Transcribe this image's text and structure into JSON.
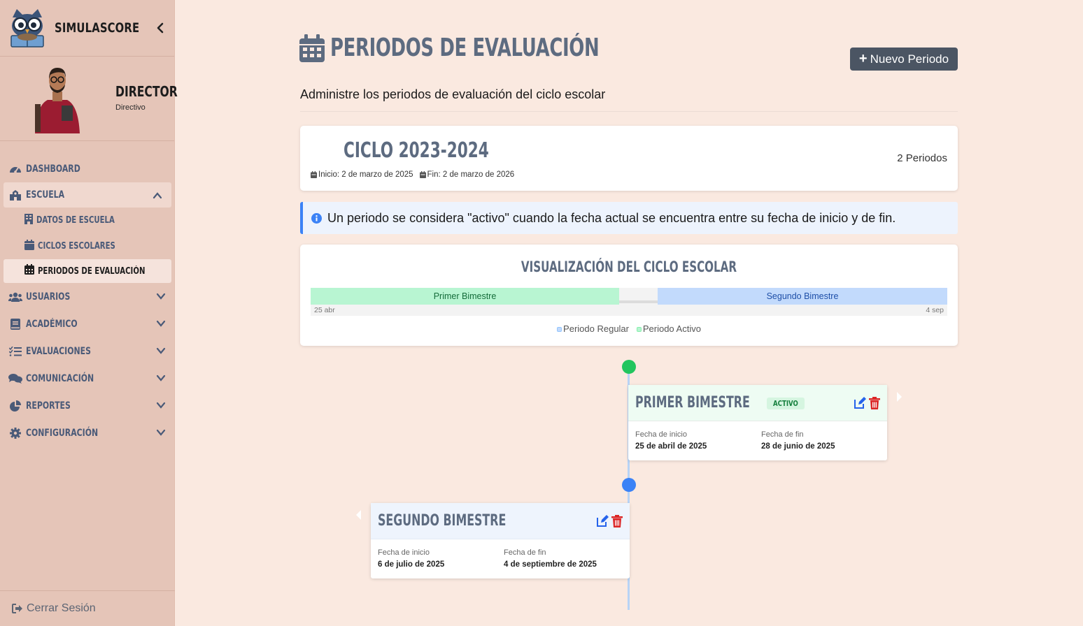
{
  "app": {
    "name": "SIMULASCORE"
  },
  "profile": {
    "role": "DIRECTOR",
    "subtitle": "Directivo"
  },
  "sidebar": {
    "items": [
      {
        "label": "DASHBOARD",
        "icon": "gauge-icon"
      },
      {
        "label": "ESCUELA",
        "icon": "school-icon",
        "expanded": true,
        "children": [
          {
            "label": "DATOS DE ESCUELA",
            "icon": "building-icon"
          },
          {
            "label": "CICLOS ESCOLARES",
            "icon": "calendar-icon"
          },
          {
            "label": "PERIODOS DE EVALUACIÓN",
            "icon": "calendar-days-icon",
            "active": true
          }
        ]
      },
      {
        "label": "USUARIOS",
        "icon": "users-icon"
      },
      {
        "label": "ACADÉMICO",
        "icon": "book-icon"
      },
      {
        "label": "EVALUACIONES",
        "icon": "list-check-icon"
      },
      {
        "label": "COMUNICACIÓN",
        "icon": "comments-icon"
      },
      {
        "label": "REPORTES",
        "icon": "chart-pie-icon"
      },
      {
        "label": "CONFIGURACIÓN",
        "icon": "gear-icon"
      }
    ],
    "logout_label": "Cerrar Sesión"
  },
  "header": {
    "title": "PERIODOS DE EVALUACIÓN",
    "subtitle": "Administre los periodos de evaluación del ciclo escolar",
    "new_button_label": "Nuevo Periodo"
  },
  "cycle": {
    "name": "CICLO 2023-2024",
    "start_label": "Inicio: 2 de marzo de 2025",
    "end_label": "Fin: 2 de marzo de 2026",
    "period_count": "2 Periodos"
  },
  "info_message": "Un periodo se considera \"activo\" cuando la fecha actual se encuentra entre su fecha de inicio y de fin.",
  "visualization": {
    "title": "VISUALIZACIÓN DEL CICLO ESCOLAR",
    "segments": [
      {
        "label": "Primer Bimestre",
        "active": true
      },
      {
        "label": "Segundo Bimestre",
        "active": false
      }
    ],
    "tick_start": "25 abr",
    "tick_end": "4 sep",
    "legend": [
      "Periodo Regular",
      "Periodo Activo"
    ],
    "colors": {
      "regular": "#93c5fd",
      "active": "#86efac"
    }
  },
  "periods": [
    {
      "name": "PRIMER BIMESTRE",
      "badge": "ACTIVO",
      "start_label": "Fecha de inicio",
      "start_value": "25 de abril de 2025",
      "end_label": "Fecha de fin",
      "end_value": "28 de junio de 2025"
    },
    {
      "name": "SEGUNDO BIMESTRE",
      "start_label": "Fecha de inicio",
      "start_value": "6 de julio de 2025",
      "end_label": "Fecha de fin",
      "end_value": "4 de septiembre de 2025"
    }
  ],
  "colors": {
    "accent": "#5d6b80",
    "active_dot": "#22c55e",
    "regular_dot": "#3b82f6",
    "edit": "#2563eb",
    "delete": "#dc2626"
  }
}
